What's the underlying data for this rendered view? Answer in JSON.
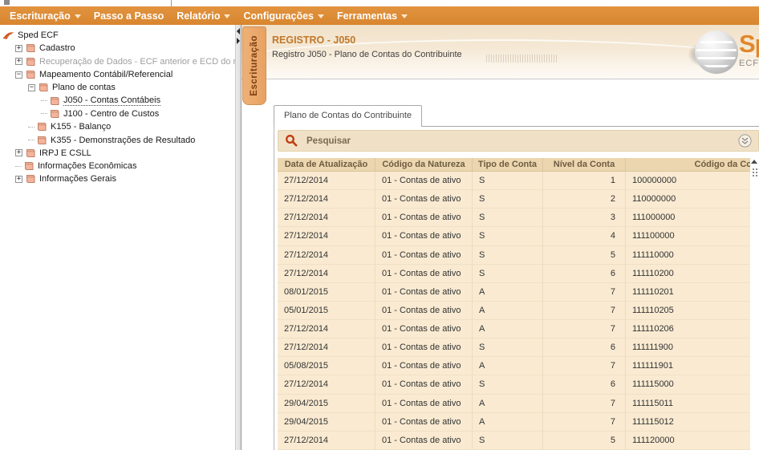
{
  "menu": {
    "items": [
      {
        "label": "Escrituração",
        "caret": true
      },
      {
        "label": "Passo a Passo",
        "caret": false
      },
      {
        "label": "Relatório",
        "caret": true
      },
      {
        "label": "Configurações",
        "caret": true
      },
      {
        "label": "Ferramentas",
        "caret": true
      }
    ]
  },
  "tree": {
    "items": [
      {
        "label": "Sped ECF",
        "level": 0,
        "expander": "none",
        "icon": "sped-root",
        "disabled": false,
        "selected": false
      },
      {
        "label": "Cadastro",
        "level": 1,
        "expander": "plus",
        "icon": "doc",
        "disabled": false,
        "selected": false
      },
      {
        "label": "Recuperação de Dados - ECF anterior e ECD do mesmo",
        "level": 1,
        "expander": "plus",
        "icon": "doc",
        "disabled": true,
        "selected": false
      },
      {
        "label": "Mapeamento Contábil/Referencial",
        "level": 1,
        "expander": "minus",
        "icon": "doc",
        "disabled": false,
        "selected": false
      },
      {
        "label": "Plano de contas",
        "level": 2,
        "expander": "minus",
        "icon": "doc",
        "disabled": false,
        "selected": false
      },
      {
        "label": "J050 - Contas Contábeis",
        "level": 3,
        "expander": "none",
        "icon": "doc",
        "disabled": false,
        "selected": true
      },
      {
        "label": "J100 - Centro de Custos",
        "level": 3,
        "expander": "none",
        "icon": "doc",
        "disabled": false,
        "selected": false
      },
      {
        "label": "K155 - Balanço",
        "level": 2,
        "expander": "none",
        "icon": "doc",
        "disabled": false,
        "selected": false
      },
      {
        "label": "K355 - Demonstrações de Resultado",
        "level": 2,
        "expander": "none",
        "icon": "doc",
        "disabled": false,
        "selected": false
      },
      {
        "label": "IRPJ E CSLL",
        "level": 1,
        "expander": "plus",
        "icon": "doc",
        "disabled": false,
        "selected": false
      },
      {
        "label": "Informações Econômicas",
        "level": 1,
        "expander": "none",
        "icon": "doc",
        "disabled": false,
        "selected": false
      },
      {
        "label": "Informações Gerais",
        "level": 1,
        "expander": "plus",
        "icon": "doc",
        "disabled": false,
        "selected": false
      }
    ]
  },
  "vertical_tab": {
    "label": "Escrituração"
  },
  "banner": {
    "title": "REGISTRO - J050",
    "subtitle": "Registro J050 - Plano de Contas do Contribuinte",
    "logo_text": "Sp",
    "logo_subtext": "ECF"
  },
  "content": {
    "tab_label": "Plano de Contas do Contribuinte",
    "search_label": "Pesquisar",
    "table": {
      "columns": [
        "Data de Atualização",
        "Código da Natureza",
        "Tipo de Conta",
        "Nível da Conta",
        "Código da Conta"
      ],
      "rows": [
        [
          "27/12/2014",
          "01 - Contas de ativo",
          "S",
          "1",
          "100000000"
        ],
        [
          "27/12/2014",
          "01 - Contas de ativo",
          "S",
          "2",
          "110000000"
        ],
        [
          "27/12/2014",
          "01 - Contas de ativo",
          "S",
          "3",
          "111000000"
        ],
        [
          "27/12/2014",
          "01 - Contas de ativo",
          "S",
          "4",
          "111100000"
        ],
        [
          "27/12/2014",
          "01 - Contas de ativo",
          "S",
          "5",
          "111110000"
        ],
        [
          "27/12/2014",
          "01 - Contas de ativo",
          "S",
          "6",
          "111110200"
        ],
        [
          "08/01/2015",
          "01 - Contas de ativo",
          "A",
          "7",
          "111110201"
        ],
        [
          "05/01/2015",
          "01 - Contas de ativo",
          "A",
          "7",
          "111110205"
        ],
        [
          "27/12/2014",
          "01 - Contas de ativo",
          "A",
          "7",
          "111110206"
        ],
        [
          "27/12/2014",
          "01 - Contas de ativo",
          "S",
          "6",
          "111111900"
        ],
        [
          "05/08/2015",
          "01 - Contas de ativo",
          "A",
          "7",
          "111111901"
        ],
        [
          "27/12/2014",
          "01 - Contas de ativo",
          "S",
          "6",
          "111115000"
        ],
        [
          "29/04/2015",
          "01 - Contas de ativo",
          "A",
          "7",
          "111115011"
        ],
        [
          "29/04/2015",
          "01 - Contas de ativo",
          "A",
          "7",
          "111115012"
        ],
        [
          "27/12/2014",
          "01 - Contas de ativo",
          "S",
          "5",
          "111120000"
        ]
      ]
    }
  },
  "colors": {
    "menubar": "#d8862f",
    "banner_top": "#f1e1c8",
    "title": "#c1782a",
    "vtab_bg": "#e8a262",
    "search_bg": "#f0e1c6",
    "table_header_bg": "#ebd6af",
    "row_bg": "#f9ead1",
    "search_icon": "#c23a10",
    "logo_orange": "#e2872b"
  }
}
